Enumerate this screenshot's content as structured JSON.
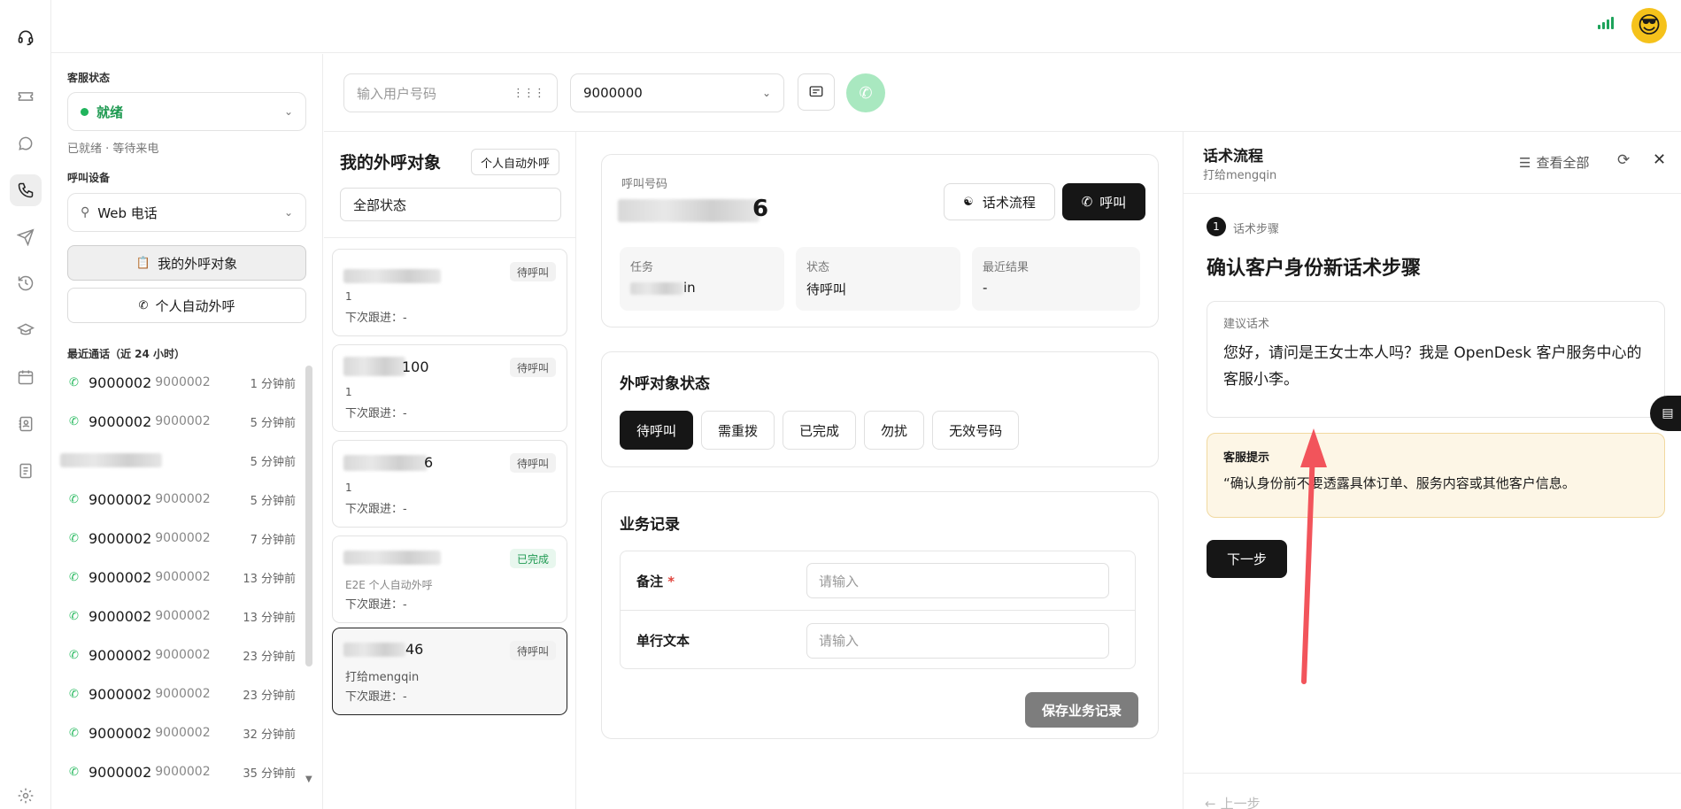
{
  "rail": {
    "icons": [
      "headset-icon",
      "ticket-icon",
      "chat-icon",
      "phone-icon",
      "send-icon",
      "history-icon",
      "graduation-icon",
      "calendar-icon",
      "contacts-icon",
      "document-icon",
      "settings-icon"
    ]
  },
  "topbar": {
    "signal": "signal-bars-icon",
    "avatar": "😎"
  },
  "agent": {
    "status_label": "客服状态",
    "status_value": "就绪",
    "status_hint": "已就绪 · 等待来电",
    "device_label": "呼叫设备",
    "device_value": "Web 电话",
    "my_targets_btn": "我的外呼对象",
    "auto_call_btn": "个人自动外呼",
    "recent_title": "最近通话（近 24 小时）",
    "recent": [
      {
        "num": "9000002",
        "num2": "9000002",
        "time": "1 分钟前"
      },
      {
        "num": "9000002",
        "num2": "9000002",
        "time": "5 分钟前"
      },
      {
        "num": "",
        "num2": "",
        "time": "5 分钟前"
      },
      {
        "num": "9000002",
        "num2": "9000002",
        "time": "5 分钟前"
      },
      {
        "num": "9000002",
        "num2": "9000002",
        "time": "7 分钟前"
      },
      {
        "num": "9000002",
        "num2": "9000002",
        "time": "13 分钟前"
      },
      {
        "num": "9000002",
        "num2": "9000002",
        "time": "13 分钟前"
      },
      {
        "num": "9000002",
        "num2": "9000002",
        "time": "23 分钟前"
      },
      {
        "num": "9000002",
        "num2": "9000002",
        "time": "23 分钟前"
      },
      {
        "num": "9000002",
        "num2": "9000002",
        "time": "32 分钟前"
      },
      {
        "num": "9000002",
        "num2": "9000002",
        "time": "35 分钟前"
      }
    ]
  },
  "callbar": {
    "phone_placeholder": "输入用户号码",
    "caller_id": "9000000"
  },
  "targets": {
    "title": "我的外呼对象",
    "auto_btn": "个人自动外呼",
    "filter": "全部状态",
    "cards": [
      {
        "name_suffix": "",
        "sub": "1",
        "status": "待呼叫",
        "next": "下次跟进：-"
      },
      {
        "name_suffix": "100",
        "sub": "1",
        "status": "待呼叫",
        "next": "下次跟进：-"
      },
      {
        "name_suffix": "6",
        "sub": "1",
        "status": "待呼叫",
        "next": "下次跟进：-"
      },
      {
        "name_suffix": "",
        "sub": "E2E 个人自动外呼",
        "status": "已完成",
        "next": "下次跟进：-"
      },
      {
        "name_suffix": "46",
        "sub": "打给mengqin",
        "status": "待呼叫",
        "next": "下次跟进：-"
      }
    ]
  },
  "call": {
    "number_label": "呼叫号码",
    "number_suffix": "6",
    "script_btn": "话术流程",
    "call_btn": "呼叫",
    "task_label": "任务",
    "task_value": "in",
    "state_label": "状态",
    "state_value": "待呼叫",
    "result_label": "最近结果",
    "result_value": "-"
  },
  "target_status": {
    "title": "外呼对象状态",
    "options": [
      "待呼叫",
      "需重拨",
      "已完成",
      "勿扰",
      "无效号码"
    ],
    "selected": "待呼叫"
  },
  "business": {
    "title": "业务记录",
    "fields": [
      {
        "label": "备注",
        "required": "*",
        "placeholder": "请输入"
      },
      {
        "label": "单行文本",
        "required": "",
        "placeholder": "请输入"
      }
    ],
    "save_btn": "保存业务记录"
  },
  "script": {
    "title": "话术流程",
    "subtitle": "打给mengqin",
    "view_all": "查看全部",
    "step_num": "1",
    "step_label": "话术步骤",
    "step_title": "确认客户身份新话术步骤",
    "suggest_label": "建议话术",
    "suggest_text": "您好，请问是王女士本人吗？我是 OpenDesk 客户服务中心的客服小李。",
    "tip_label": "客服提示",
    "tip_text": "“确认身份前不要透露具体订单、服务内容或其他客户信息。",
    "next_btn": "下一步",
    "prev_btn": "上一步"
  },
  "colors": {
    "accent": "#161616",
    "green": "#20b45c",
    "tip_bg": "#fdf6e6",
    "arrow": "#f2545b"
  }
}
